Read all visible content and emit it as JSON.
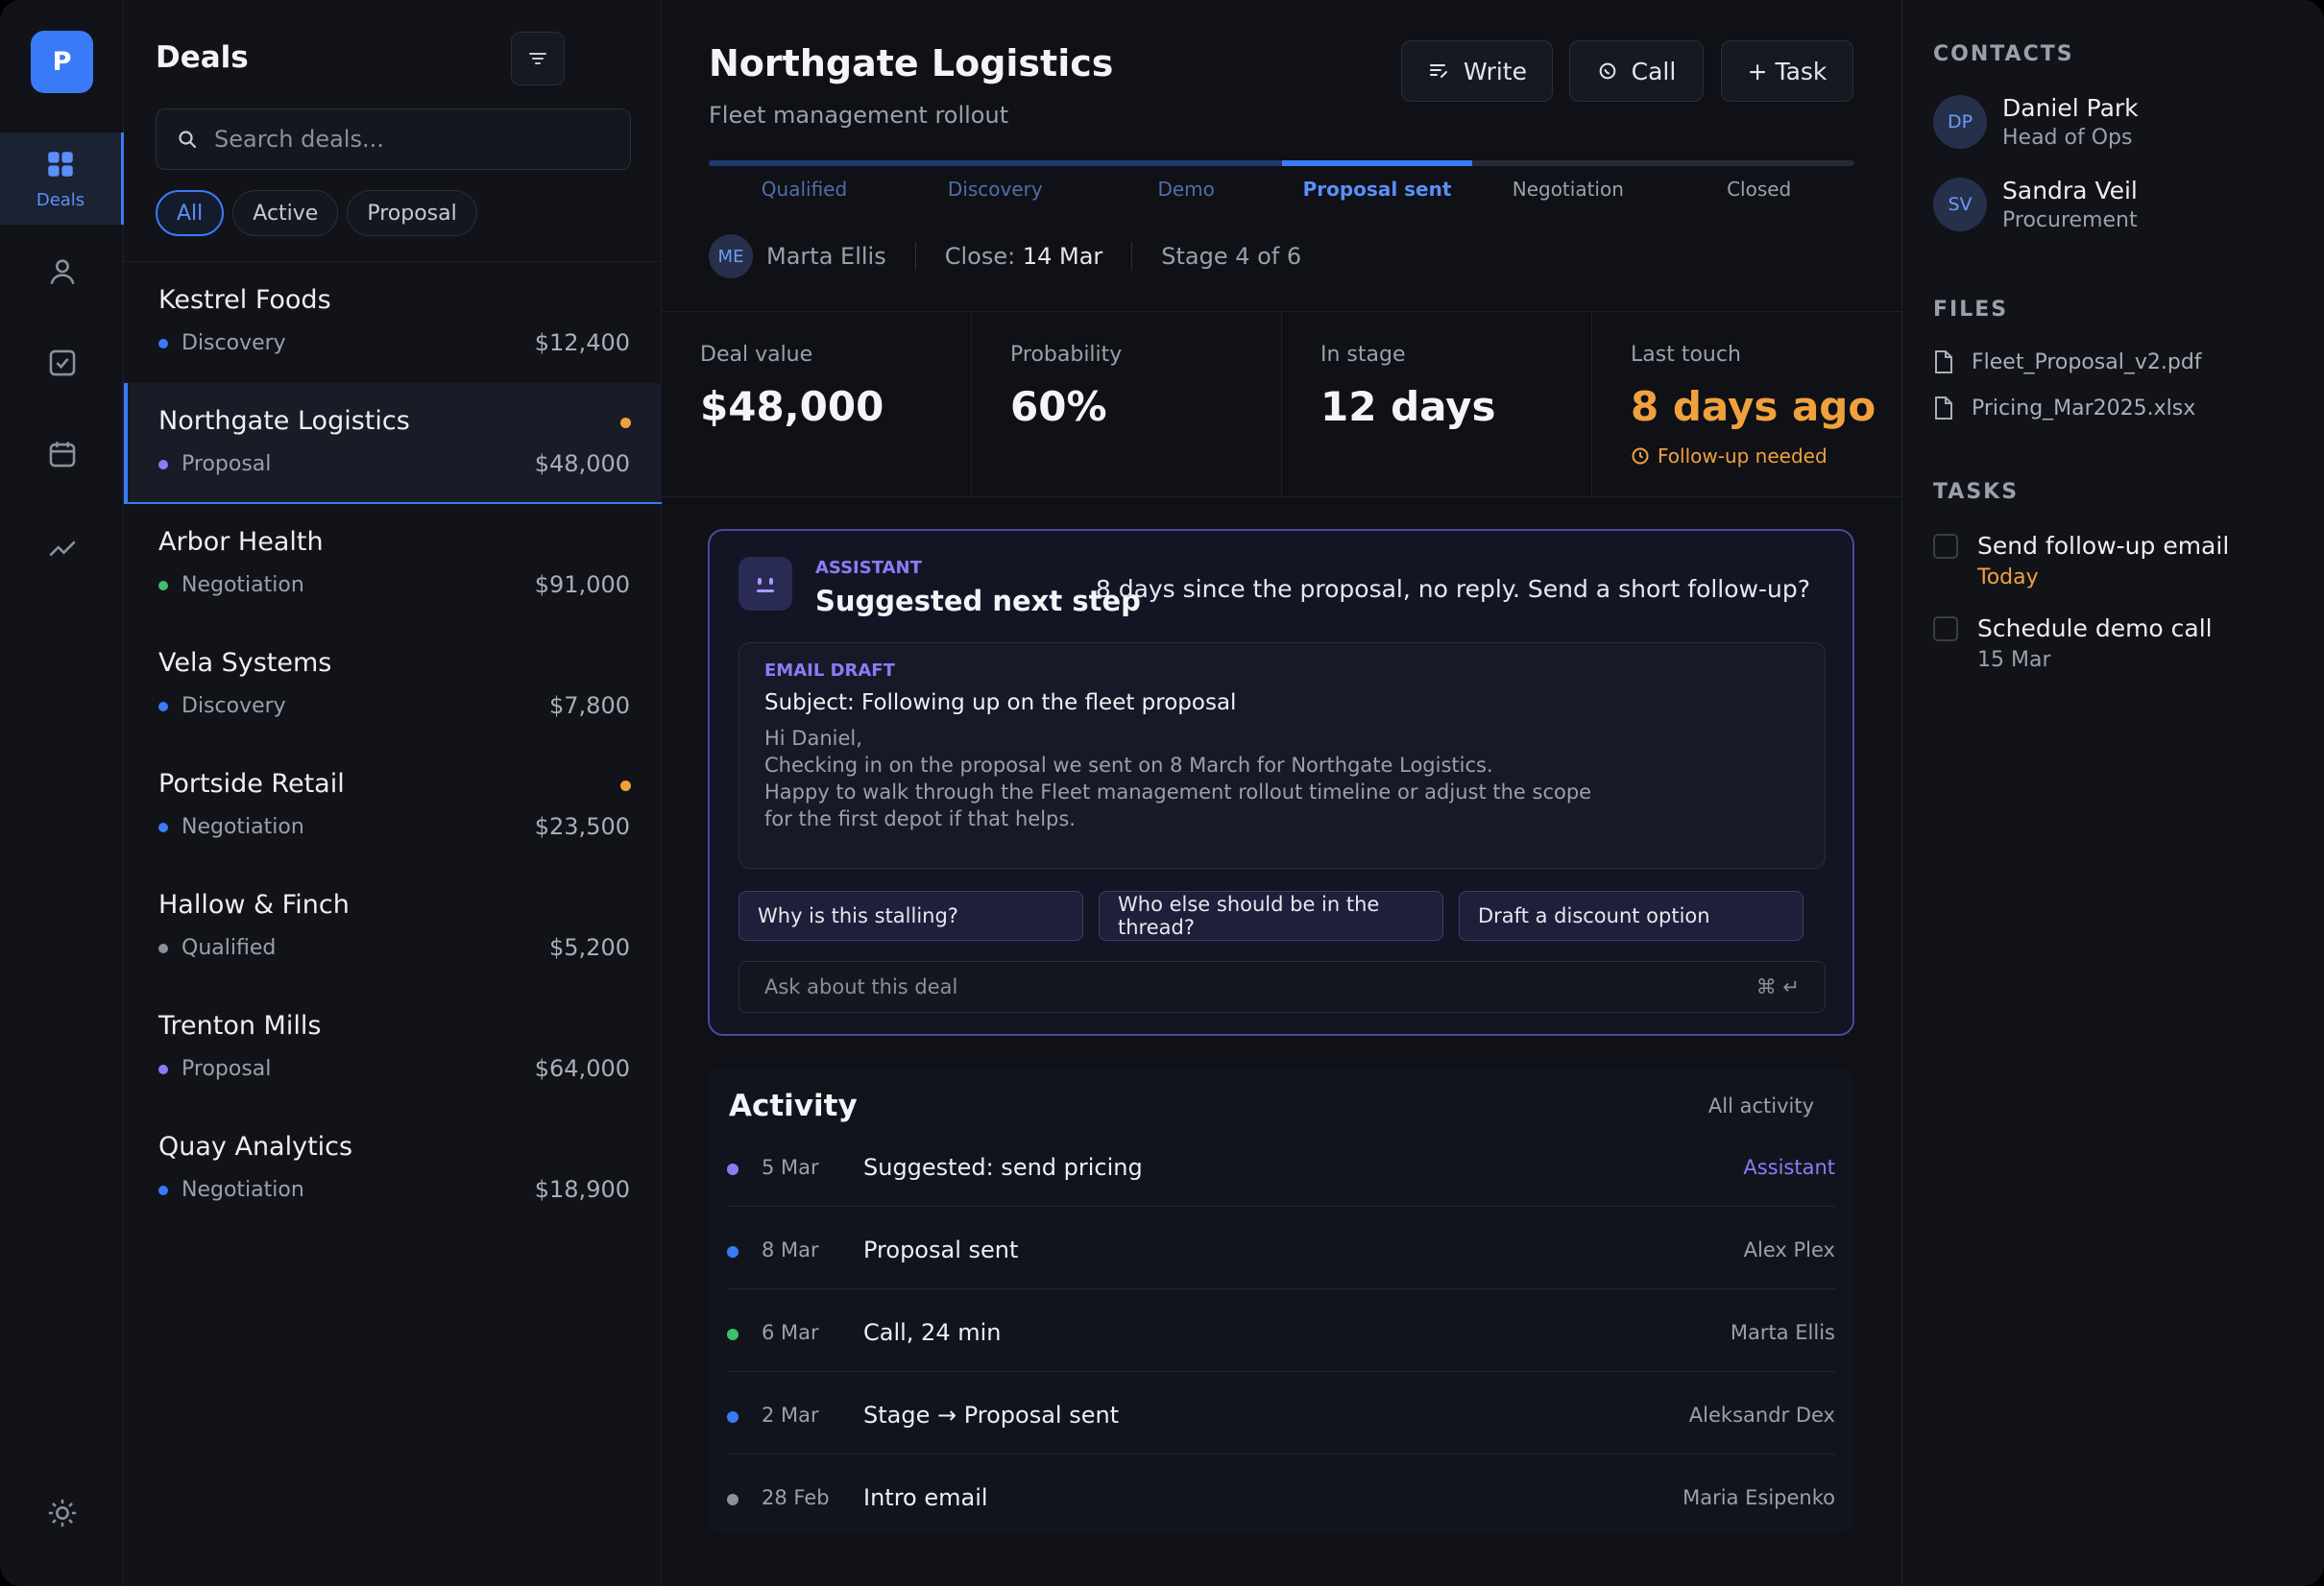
{
  "rail": {
    "logo": "P",
    "items": [
      {
        "label": "Deals",
        "icon": "grid-icon"
      },
      {
        "icon": "person-icon"
      },
      {
        "icon": "checkbox-icon"
      },
      {
        "icon": "calendar-icon"
      },
      {
        "icon": "trend-icon"
      }
    ],
    "settings_icon": "sun-icon"
  },
  "list": {
    "title": "Deals",
    "search_placeholder": "Search deals...",
    "filters": [
      "All",
      "Active",
      "Proposal"
    ],
    "deals": [
      {
        "name": "Kestrel Foods",
        "stage": "Discovery",
        "amount": "$12,400",
        "dot": "#3b7af7",
        "flag": false
      },
      {
        "name": "Northgate Logistics",
        "stage": "Proposal",
        "amount": "$48,000",
        "dot": "#8b7cf6",
        "flag": true
      },
      {
        "name": "Arbor Health",
        "stage": "Negotiation",
        "amount": "$91,000",
        "dot": "#3fbf6a",
        "flag": false
      },
      {
        "name": "Vela Systems",
        "stage": "Discovery",
        "amount": "$7,800",
        "dot": "#3b7af7",
        "flag": false
      },
      {
        "name": "Portside Retail",
        "stage": "Negotiation",
        "amount": "$23,500",
        "dot": "#3b7af7",
        "flag": true
      },
      {
        "name": "Hallow & Finch",
        "stage": "Qualified",
        "amount": "$5,200",
        "dot": "#8b909c",
        "flag": false
      },
      {
        "name": "Trenton Mills",
        "stage": "Proposal",
        "amount": "$64,000",
        "dot": "#8b7cf6",
        "flag": false
      },
      {
        "name": "Quay Analytics",
        "stage": "Negotiation",
        "amount": "$18,900",
        "dot": "#3b7af7",
        "flag": false
      }
    ]
  },
  "deal": {
    "title": "Northgate Logistics",
    "subtitle": "Fleet management rollout",
    "actions": {
      "write": "Write",
      "call": "Call",
      "task": "+ Task"
    },
    "stages": [
      "Qualified",
      "Discovery",
      "Demo",
      "Proposal sent",
      "Negotiation",
      "Closed"
    ],
    "current_stage_index": 3,
    "owner_initials": "ME",
    "owner": "Marta Ellis",
    "close_label": "Close:",
    "close_date": "14 Mar",
    "stage_progress": "Stage 4 of 6",
    "stats": [
      {
        "label": "Deal value",
        "value": "$48,000"
      },
      {
        "label": "Probability",
        "value": "60%"
      },
      {
        "label": "In stage",
        "value": "12 days"
      },
      {
        "label": "Last touch",
        "value": "8 days ago",
        "note": "Follow-up needed"
      }
    ]
  },
  "assistant": {
    "tag": "ASSISTANT",
    "title": "Suggested next step",
    "message": "8 days since the proposal, no reply. Send a short follow-up?",
    "draft": {
      "tag": "EMAIL DRAFT",
      "subject": "Subject: Following up on the fleet proposal",
      "lines": [
        "Hi Daniel,",
        "Checking in on the proposal we sent on 8 March for Northgate Logistics.",
        "Happy to walk through the Fleet management rollout timeline or adjust the scope",
        "for the first depot if that helps."
      ]
    },
    "suggestions": [
      "Why is this stalling?",
      "Who else should be in the thread?",
      "Draft a discount option"
    ],
    "ask_placeholder": "Ask about this deal",
    "shortcut": "⌘ ↵"
  },
  "activity": {
    "title": "Activity",
    "all_label": "All activity",
    "items": [
      {
        "date": "5 Mar",
        "text": "Suggested: send pricing",
        "who": "Assistant",
        "dot": "#8b7cf6",
        "who_color": "#8b7cf6"
      },
      {
        "date": "8 Mar",
        "text": "Proposal sent",
        "who": "Alex Plex",
        "dot": "#3b7af7",
        "who_color": "#9aa0ab"
      },
      {
        "date": "6 Mar",
        "text": "Call, 24 min",
        "who": "Marta Ellis",
        "dot": "#3fbf6a",
        "who_color": "#9aa0ab"
      },
      {
        "date": "2 Mar",
        "text": "Stage → Proposal sent",
        "who": "Aleksandr Dex",
        "dot": "#3b7af7",
        "who_color": "#9aa0ab"
      },
      {
        "date": "28 Feb",
        "text": "Intro email",
        "who": "Maria Esipenko",
        "dot": "#8b909c",
        "who_color": "#9aa0ab"
      }
    ]
  },
  "sidebar": {
    "contacts_title": "CONTACTS",
    "contacts": [
      {
        "initials": "DP",
        "name": "Daniel Park",
        "role": "Head of Ops"
      },
      {
        "initials": "SV",
        "name": "Sandra Veil",
        "role": "Procurement"
      }
    ],
    "files_title": "FILES",
    "files": [
      "Fleet_Proposal_v2.pdf",
      "Pricing_Mar2025.xlsx"
    ],
    "tasks_title": "TASKS",
    "tasks": [
      {
        "name": "Send follow-up email",
        "due": "Today",
        "due_color": "#f0a13c"
      },
      {
        "name": "Schedule demo call",
        "due": "15 Mar",
        "due_color": "#9aa0ab"
      }
    ]
  }
}
